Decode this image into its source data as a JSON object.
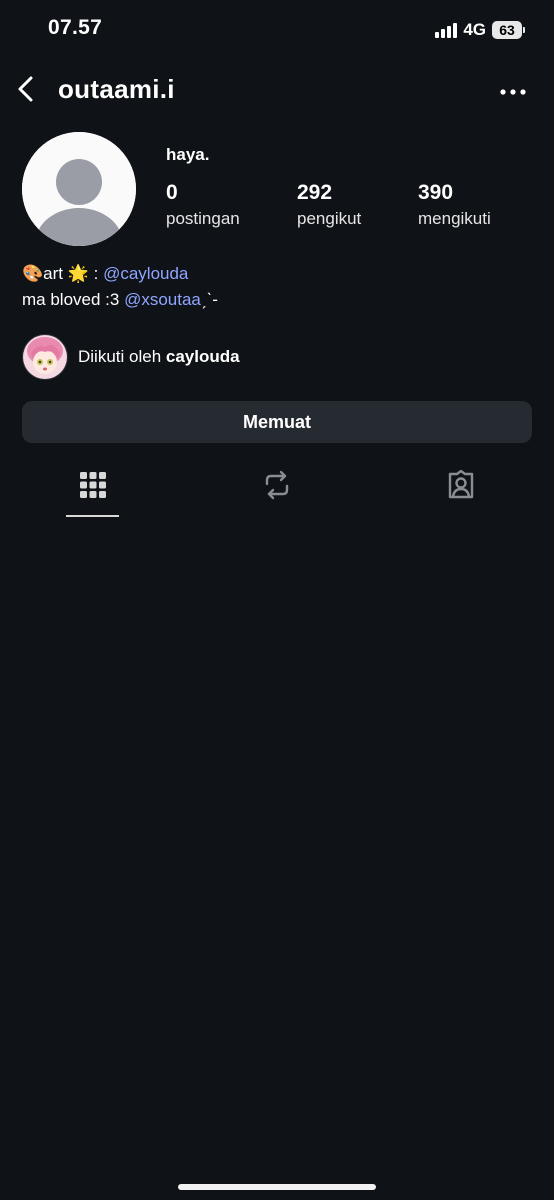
{
  "status_bar": {
    "time": "07.57",
    "network": "4G",
    "battery": "63"
  },
  "header": {
    "username": "outaami.i",
    "back_icon": "chevron-left-icon",
    "more_icon": "more-horizontal-icon"
  },
  "profile": {
    "display_name": "haya.",
    "stats": [
      {
        "value": "0",
        "label": "postingan"
      },
      {
        "value": "292",
        "label": "pengikut"
      },
      {
        "value": "390",
        "label": "mengikuti"
      }
    ],
    "bio": {
      "line1_prefix": "🎨art 🌟 : ",
      "line1_mention": "@caylouda",
      "line2_prefix": "ma bloved :3 ",
      "line2_mention": "@xsoutaa",
      "line2_suffix": "ˏˋ-"
    },
    "followed_by": {
      "prefix": "Diikuti oleh ",
      "name": "caylouda"
    }
  },
  "load_button": {
    "label": "Memuat"
  },
  "tabs": [
    {
      "icon": "grid-icon",
      "active": true
    },
    {
      "icon": "repost-icon",
      "active": false
    },
    {
      "icon": "tagged-icon",
      "active": false
    }
  ],
  "colors": {
    "background": "#0f1217",
    "mention": "#8ea6ff",
    "button": "#262a31"
  }
}
